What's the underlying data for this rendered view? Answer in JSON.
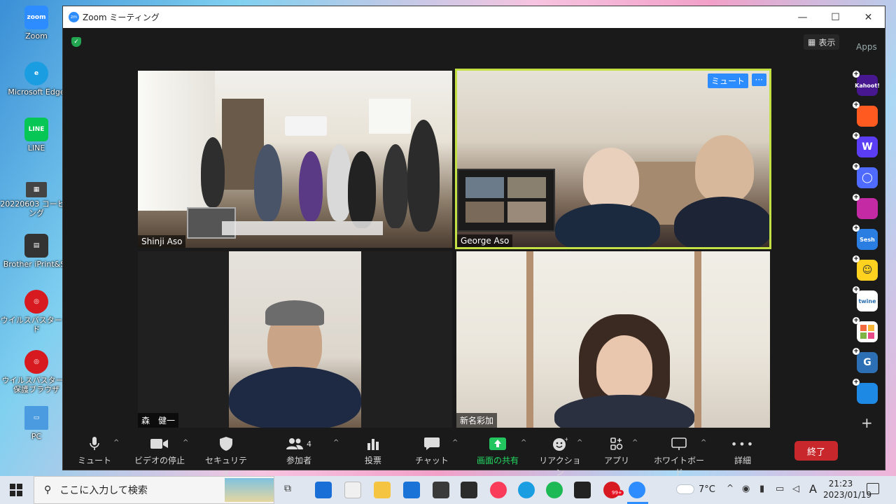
{
  "desktop": {
    "icons": [
      {
        "label": "Zoom",
        "color": "#2d8cff",
        "glyph": "zoom"
      },
      {
        "label": "Microsoft Edge",
        "color": "#1b9de2",
        "glyph": "e"
      },
      {
        "label": "LINE",
        "color": "#06c755",
        "glyph": "LINE"
      },
      {
        "label": "20220603 コーヒーング",
        "color": "#555555",
        "glyph": "▦"
      },
      {
        "label": "Brother iPrint&Sc",
        "color": "#333333",
        "glyph": "▤"
      },
      {
        "label": "ウイルスバスター クド",
        "color": "#d71920",
        "glyph": "◎"
      },
      {
        "label": "ウイルスバスター決保護ブラウザ",
        "color": "#d71920",
        "glyph": "◎"
      },
      {
        "label": "PC",
        "color": "#4a9be0",
        "glyph": "▭"
      }
    ]
  },
  "window": {
    "title": "Zoom ミーティング",
    "view_label": "表示",
    "apps_label": "Apps"
  },
  "tiles": [
    {
      "name": "Shinji Aso"
    },
    {
      "name": "George Aso",
      "mute_label": "ミュート",
      "more_label": "···"
    },
    {
      "name": "森　健一"
    },
    {
      "name": "新名彩加"
    }
  ],
  "toolbar": {
    "mute": "ミュート",
    "video": "ビデオの停止",
    "security": "セキュリティ",
    "participants": "参加者",
    "participants_count": "4",
    "poll": "投票",
    "chat": "チャット",
    "share": "画面の共有",
    "reactions": "リアクション",
    "apps": "アプリ",
    "whiteboard": "ホワイトボード",
    "more": "詳細",
    "end": "終了"
  },
  "apps_panel": [
    {
      "label": "Kahoot!",
      "color": "#46178f"
    },
    {
      "label": "",
      "color": "#ff5a1f"
    },
    {
      "label": "W",
      "color": "#5b3df5"
    },
    {
      "label": "◯",
      "color": "#4f6bff"
    },
    {
      "label": "",
      "color": "#c32aa3"
    },
    {
      "label": "Sesh",
      "color": "#2a7de1"
    },
    {
      "label": "☺",
      "color": "#ffd21f"
    },
    {
      "label": "twine",
      "color": "#ffffff"
    },
    {
      "label": "",
      "color": "#ffffff"
    },
    {
      "label": "G",
      "color": "#2c6fb5"
    },
    {
      "label": "",
      "color": "#1e88e5"
    }
  ],
  "taskbar": {
    "search_placeholder": "ここに入力して検索",
    "weather": "7°C",
    "ime": "A",
    "time": "21:23",
    "date": "2023/01/19",
    "badge": "99+"
  }
}
